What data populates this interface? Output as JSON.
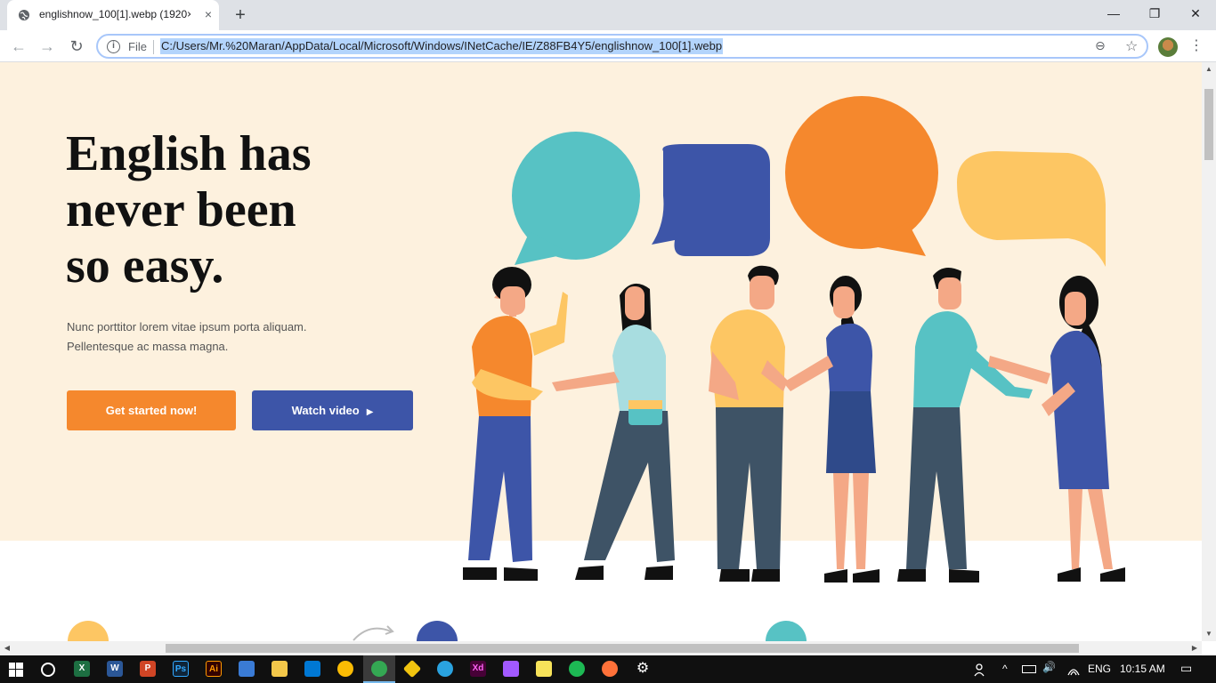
{
  "browser": {
    "tab": {
      "title": "englishnow_100[1].webp (1920×",
      "close_icon": "×",
      "favicon": "globe-icon"
    },
    "new_tab_icon": "+",
    "window_controls": {
      "minimize": "—",
      "maximize": "❐",
      "close": "✕"
    },
    "toolbar": {
      "back_icon": "←",
      "forward_icon": "→",
      "reload_icon": "↻",
      "info_icon": "i",
      "file_label": "File",
      "url": "C:/Users/Mr.%20Maran/AppData/Local/Microsoft/Windows/INetCache/IE/Z88FB4Y5/englishnow_100[1].webp",
      "zoom_icon": "⊖",
      "star_icon": "☆",
      "menu_icon": "⋮"
    }
  },
  "hero": {
    "headline_line1": "English has",
    "headline_line2": "never been",
    "headline_line3": "so easy.",
    "subtext_line1": "Nunc porttitor lorem vitae ipsum porta aliquam.",
    "subtext_line2": "Pellentesque ac massa magna.",
    "primary_button": "Get started now!",
    "secondary_button": "Watch video",
    "play_icon": "▶"
  },
  "colors": {
    "hero_bg": "#fdf1de",
    "orange": "#f5882d",
    "blue": "#3d55a8",
    "teal": "#57c2c4",
    "yellow": "#fdc663"
  },
  "scrollbars": {
    "up": "▲",
    "down": "▼",
    "left": "◀",
    "right": "▶"
  },
  "taskbar": {
    "apps": [
      "X",
      "W",
      "P",
      "Ps",
      "Ai",
      "",
      "",
      "",
      "",
      "",
      "",
      "",
      "Xd",
      "",
      "",
      "",
      "",
      "⚙"
    ],
    "tray": {
      "language": "ENG",
      "time": "10:15 AM",
      "chevron": "^",
      "volume_icon": "🔊",
      "notification_icon": "▭"
    }
  }
}
